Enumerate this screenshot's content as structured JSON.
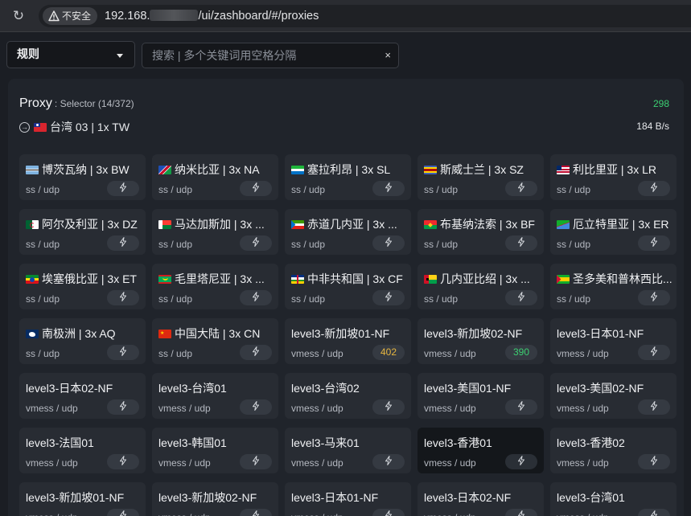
{
  "browser": {
    "security_label": "不安全",
    "url_host": "192.168.",
    "url_path": "/ui/zashboard/#/proxies"
  },
  "toolbar": {
    "mode_value": "规则",
    "search_placeholder": "搜索 | 多个关键词用空格分隔",
    "clear_symbol": "×"
  },
  "group": {
    "name": "Proxy",
    "meta": ": Selector (14/372)",
    "latency": "298",
    "current_node": "台湾 03 | 1x TW",
    "current_flag": "tw",
    "speed": "184 B/s"
  },
  "colors": {
    "latency_green": "#3ccf72",
    "latency_yellow": "#e6b640",
    "card_bg": "#282c33",
    "panel_bg": "#20242b"
  },
  "nodes": [
    {
      "name": "博茨瓦纳 | 3x BW",
      "flag": "bw",
      "proto": "ss / udp",
      "probe": "bolt"
    },
    {
      "name": "纳米比亚 | 3x NA",
      "flag": "na",
      "proto": "ss / udp",
      "probe": "bolt"
    },
    {
      "name": "塞拉利昂 | 3x SL",
      "flag": "sl",
      "proto": "ss / udp",
      "probe": "bolt"
    },
    {
      "name": "斯威士兰 | 3x SZ",
      "flag": "sz",
      "proto": "ss / udp",
      "probe": "bolt"
    },
    {
      "name": "利比里亚 | 3x LR",
      "flag": "lr",
      "proto": "ss / udp",
      "probe": "bolt"
    },
    {
      "name": "阿尔及利亚 | 3x DZ",
      "flag": "dz",
      "proto": "ss / udp",
      "probe": "bolt"
    },
    {
      "name": "马达加斯加 | 3x ...",
      "flag": "mg",
      "proto": "ss / udp",
      "probe": "bolt"
    },
    {
      "name": "赤道几内亚 | 3x ...",
      "flag": "gq",
      "proto": "ss / udp",
      "probe": "bolt"
    },
    {
      "name": "布基纳法索 | 3x BF",
      "flag": "bf",
      "proto": "ss / udp",
      "probe": "bolt"
    },
    {
      "name": "厄立特里亚 | 3x ER",
      "flag": "er",
      "proto": "ss / udp",
      "probe": "bolt"
    },
    {
      "name": "埃塞俄比亚 | 3x ET",
      "flag": "et",
      "proto": "ss / udp",
      "probe": "bolt"
    },
    {
      "name": "毛里塔尼亚 | 3x ...",
      "flag": "mr",
      "proto": "ss / udp",
      "probe": "bolt"
    },
    {
      "name": "中非共和国 | 3x CF",
      "flag": "cf",
      "proto": "ss / udp",
      "probe": "bolt"
    },
    {
      "name": "几内亚比绍 | 3x ...",
      "flag": "gw",
      "proto": "ss / udp",
      "probe": "bolt"
    },
    {
      "name": "圣多美和普林西比...",
      "flag": "st",
      "proto": "ss / udp",
      "probe": "bolt"
    },
    {
      "name": "南极洲 | 3x AQ",
      "flag": "aq",
      "proto": "ss / udp",
      "probe": "bolt"
    },
    {
      "name": "中国大陆 | 3x CN",
      "flag": "cn",
      "proto": "ss / udp",
      "probe": "bolt"
    },
    {
      "name": "level3-新加坡01-NF",
      "flag": "",
      "proto": "vmess / udp",
      "probe": "402",
      "probe_color": "yellow"
    },
    {
      "name": "level3-新加坡02-NF",
      "flag": "",
      "proto": "vmess / udp",
      "probe": "390",
      "probe_color": "green"
    },
    {
      "name": "level3-日本01-NF",
      "flag": "",
      "proto": "vmess / udp",
      "probe": "bolt"
    },
    {
      "name": "level3-日本02-NF",
      "flag": "",
      "proto": "vmess / udp",
      "probe": "bolt"
    },
    {
      "name": "level3-台湾01",
      "flag": "",
      "proto": "vmess / udp",
      "probe": "bolt"
    },
    {
      "name": "level3-台湾02",
      "flag": "",
      "proto": "vmess / udp",
      "probe": "bolt"
    },
    {
      "name": "level3-美国01-NF",
      "flag": "",
      "proto": "vmess / udp",
      "probe": "bolt"
    },
    {
      "name": "level3-美国02-NF",
      "flag": "",
      "proto": "vmess / udp",
      "probe": "bolt"
    },
    {
      "name": "level3-法国01",
      "flag": "",
      "proto": "vmess / udp",
      "probe": "bolt"
    },
    {
      "name": "level3-韩国01",
      "flag": "",
      "proto": "vmess / udp",
      "probe": "bolt"
    },
    {
      "name": "level3-马来01",
      "flag": "",
      "proto": "vmess / udp",
      "probe": "bolt"
    },
    {
      "name": "level3-香港01",
      "flag": "",
      "proto": "vmess / udp",
      "probe": "bolt",
      "active": true
    },
    {
      "name": "level3-香港02",
      "flag": "",
      "proto": "vmess / udp",
      "probe": "bolt"
    },
    {
      "name": "level3-新加坡01-NF",
      "flag": "",
      "proto": "vmess / udp",
      "probe": "bolt"
    },
    {
      "name": "level3-新加坡02-NF",
      "flag": "",
      "proto": "vmess / udp",
      "probe": "bolt"
    },
    {
      "name": "level3-日本01-NF",
      "flag": "",
      "proto": "vmess / udp",
      "probe": "bolt"
    },
    {
      "name": "level3-日本02-NF",
      "flag": "",
      "proto": "vmess / udp",
      "probe": "bolt"
    },
    {
      "name": "level3-台湾01",
      "flag": "",
      "proto": "vmess / udp",
      "probe": "bolt"
    }
  ]
}
